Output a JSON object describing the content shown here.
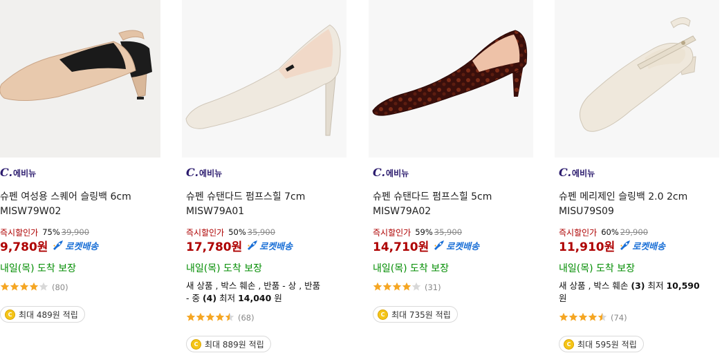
{
  "products": [
    {
      "brand_mark": "C.",
      "brand_name": "에비뉴",
      "title_line1": "슈펜 여성용 스퀘어 슬링백 6cm",
      "title_line2": "MISW79W02",
      "instant_label": "즉시할인가",
      "discount": "75%",
      "original_price": "39,900",
      "price": "9,780원",
      "rocket_label": "로켓배송",
      "arrival": "내일(목) 도착 보장",
      "used_line1": "",
      "used_line2": "",
      "rating_stars": 4,
      "rating_count": "(80)",
      "cashback": "최대 489원 적립",
      "shoe_color": "#e8c9ad"
    },
    {
      "brand_mark": "C.",
      "brand_name": "에비뉴",
      "title_line1": "슈펜 슈탠다드 펌프스힐 7cm",
      "title_line2": "MISW79A01",
      "instant_label": "즉시할인가",
      "discount": "50%",
      "original_price": "35,900",
      "price": "17,780원",
      "rocket_label": "로켓배송",
      "arrival": "내일(목) 도착 보장",
      "used_prefix": "새 상품 , 박스 훼손 , 반품 - 상 , 반품",
      "used_mid": "- 중",
      "used_count": "(4)",
      "used_label": "최저",
      "used_price": "14,040",
      "used_unit": "원",
      "rating_stars": 4.5,
      "rating_count": "(68)",
      "cashback": "최대 889원 적립",
      "shoe_color": "#efe9df"
    },
    {
      "brand_mark": "C.",
      "brand_name": "에비뉴",
      "title_line1": "슈펜 슈탠다드 펌프스힐 5cm",
      "title_line2": "MISW79A02",
      "instant_label": "즉시할인가",
      "discount": "59%",
      "original_price": "35,900",
      "price": "14,710원",
      "rocket_label": "로켓배송",
      "arrival": "내일(목) 도착 보장",
      "rating_stars": 4,
      "rating_count": "(31)",
      "cashback": "최대 735원 적립",
      "shoe_color": "#4a1712"
    },
    {
      "brand_mark": "C.",
      "brand_name": "에비뉴",
      "title_line1": "슈펜 메리제인 슬링백 2.0 2cm",
      "title_line2": "MISU79S09",
      "instant_label": "즉시할인가",
      "discount": "60%",
      "original_price": "29,900",
      "price": "11,910원",
      "rocket_label": "로켓배송",
      "arrival": "내일(목) 도착 보장",
      "used_prefix": "새 상품 , 박스 훼손",
      "used_count": "(3)",
      "used_label": "최저",
      "used_price": "10,590",
      "used_unit": "원",
      "rating_stars": 4.5,
      "rating_count": "(74)",
      "cashback": "최대 595원 적립",
      "shoe_color": "#efe8dc"
    }
  ],
  "colors": {
    "price_red": "#ae0000",
    "arrival_green": "#008c00",
    "rocket_blue": "#1a6fd6",
    "star_orange": "#f5a623",
    "brand_purple": "#2b1b6e"
  },
  "icons": {
    "rocket": "rocket-icon",
    "star": "star-icon",
    "coin": "coin-icon"
  }
}
